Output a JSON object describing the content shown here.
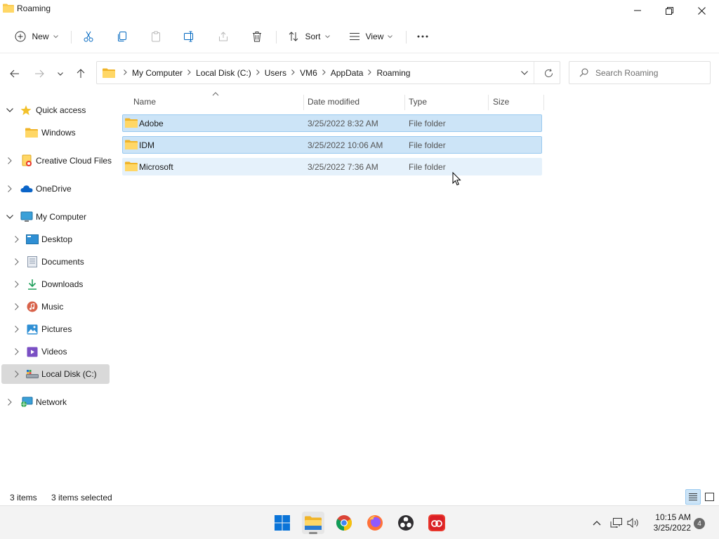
{
  "window": {
    "title": "Roaming"
  },
  "toolbar": {
    "new_label": "New",
    "sort_label": "Sort",
    "view_label": "View",
    "more_label": "···"
  },
  "address": {
    "crumbs": [
      "My Computer",
      "Local Disk (C:)",
      "Users",
      "VM6",
      "AppData",
      "Roaming"
    ]
  },
  "search": {
    "placeholder": "Search Roaming"
  },
  "sidebar": {
    "items": [
      {
        "label": "Quick access",
        "icon": "star-icon"
      },
      {
        "label": "Windows",
        "icon": "folder-icon"
      },
      {
        "label": "Creative Cloud Files",
        "icon": "creative-cloud-folder-icon"
      },
      {
        "label": "OneDrive",
        "icon": "cloud-icon"
      },
      {
        "label": "My Computer",
        "icon": "computer-icon"
      },
      {
        "label": "Desktop",
        "icon": "desktop-icon"
      },
      {
        "label": "Documents",
        "icon": "documents-icon"
      },
      {
        "label": "Downloads",
        "icon": "download-icon"
      },
      {
        "label": "Music",
        "icon": "music-icon"
      },
      {
        "label": "Pictures",
        "icon": "pictures-icon"
      },
      {
        "label": "Videos",
        "icon": "videos-icon"
      },
      {
        "label": "Local Disk (C:)",
        "icon": "drive-icon"
      },
      {
        "label": "Network",
        "icon": "network-icon"
      }
    ]
  },
  "columns": {
    "name": "Name",
    "date": "Date modified",
    "type": "Type",
    "size": "Size"
  },
  "files": [
    {
      "name": "Adobe",
      "date": "3/25/2022 8:32 AM",
      "type": "File folder"
    },
    {
      "name": "IDM",
      "date": "3/25/2022 10:06 AM",
      "type": "File folder"
    },
    {
      "name": "Microsoft",
      "date": "3/25/2022 7:36 AM",
      "type": "File folder"
    }
  ],
  "status": {
    "count": "3 items",
    "selected": "3 items selected"
  },
  "taskbar": {
    "time": "10:15 AM",
    "date": "3/25/2022",
    "notifications": "4"
  },
  "colors": {
    "selection": "#cce4f7",
    "selection_border": "#99c9ef",
    "folder": "#f8c74a",
    "accent": "#0067c0"
  }
}
